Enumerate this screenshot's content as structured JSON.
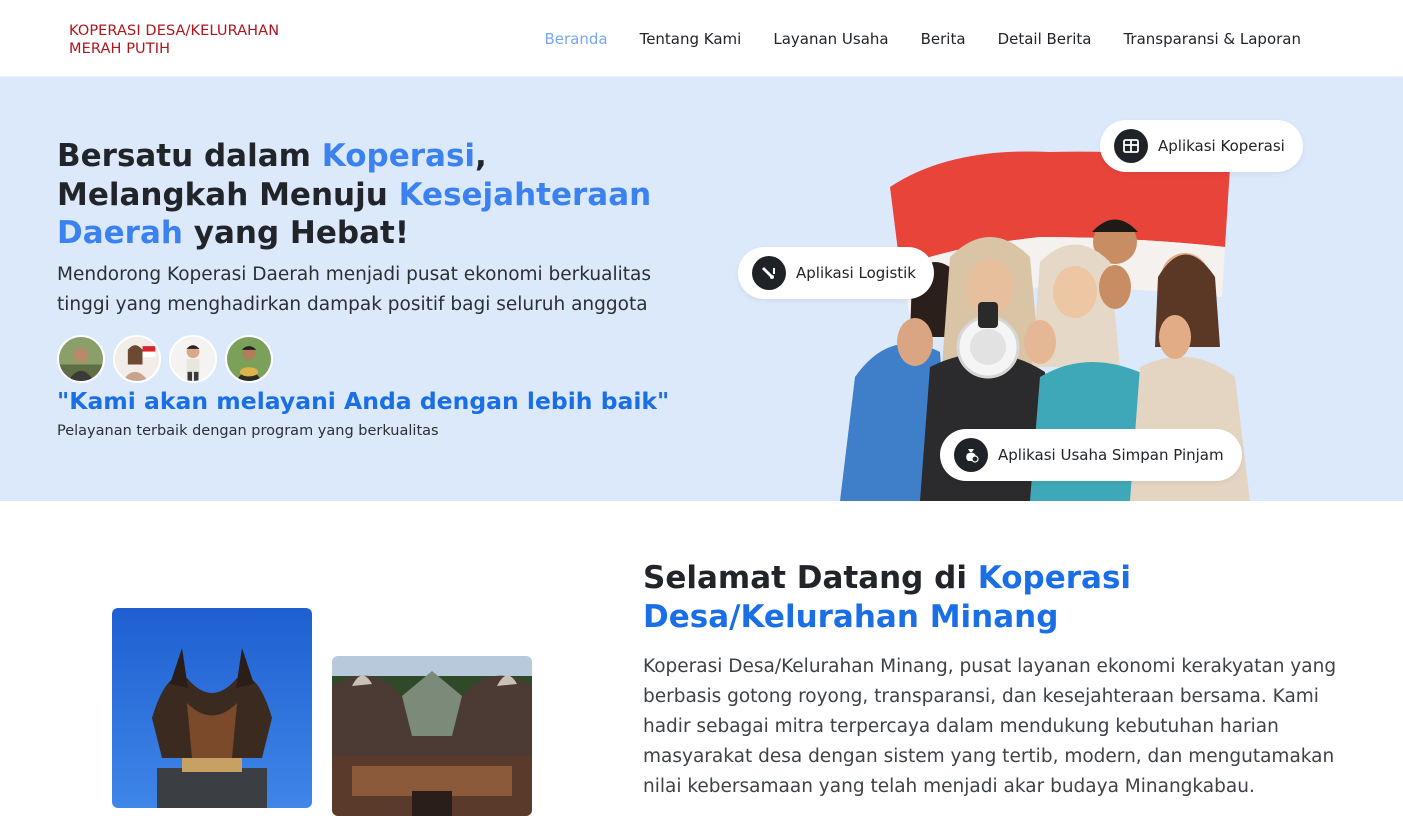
{
  "brand": {
    "line1": "KOPERASI DESA/KELURAHAN",
    "line2": "MERAH PUTIH"
  },
  "nav": {
    "items": [
      {
        "label": "Beranda",
        "active": true
      },
      {
        "label": "Tentang Kami"
      },
      {
        "label": "Layanan Usaha"
      },
      {
        "label": "Berita"
      },
      {
        "label": "Detail Berita"
      },
      {
        "label": "Transparansi & Laporan"
      }
    ]
  },
  "hero": {
    "title_1": "Bersatu dalam ",
    "title_hl1": "Koperasi",
    "title_2": ", Melangkah Menuju ",
    "title_hl2": "Kesejahteraan Daerah",
    "title_3": " yang Hebat!",
    "lead": "Mendorong Koperasi Daerah menjadi pusat ekonomi berkualitas tinggi yang menghadirkan dampak positif bagi seluruh anggota",
    "quote": "\"Kami akan melayani Anda dengan lebih baik\"",
    "quote_sub": "Pelayanan terbaik dengan program yang berkualitas",
    "pills": {
      "koperasi": "Aplikasi Koperasi",
      "logistik": "Aplikasi Logistik",
      "simpan_pinjam": "Aplikasi Usaha Simpan Pinjam"
    }
  },
  "welcome": {
    "title_1": "Selamat Datang di ",
    "title_hl": "Koperasi Desa/Kelurahan Minang",
    "body": "Koperasi Desa/Kelurahan Minang, pusat layanan ekonomi kerakyatan yang berbasis gotong royong, transparansi, dan kesejahteraan bersama. Kami hadir sebagai mitra terpercaya dalam mendukung kebutuhan harian masyarakat desa dengan sistem yang tertib, modern, dan mengutamakan nilai kebersamaan yang telah menjadi akar budaya Minangkabau."
  },
  "colors": {
    "accent": "#3b82f0",
    "brand_red": "#b0151c",
    "hero_bg": "#dce9fb",
    "nav_active": "#79a7ee"
  }
}
